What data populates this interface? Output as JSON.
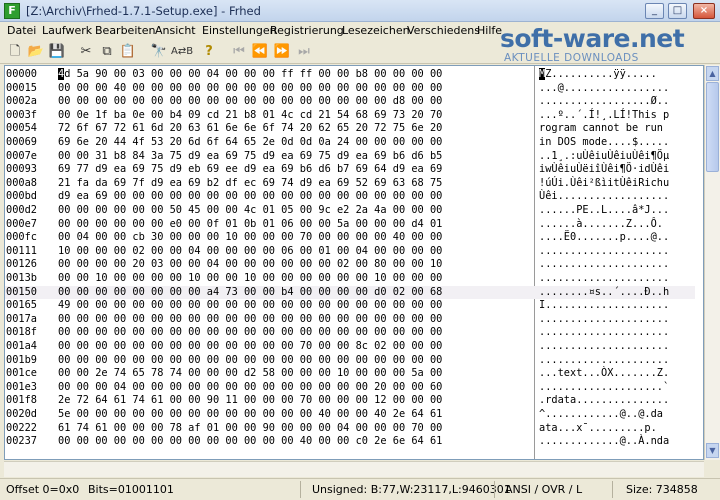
{
  "window": {
    "title": "[Z:\\Archiv\\Frhed-1.7.1-Setup.exe] - Frhed",
    "app_icon_letter": "F",
    "controls": {
      "minimize": "_",
      "maximize": "□",
      "close": "×"
    }
  },
  "menu": [
    "Datei",
    "Laufwerk",
    "Bearbeiten",
    "Ansicht",
    "Einstellungen",
    "Registrierung",
    "Lesezeichen",
    "Verschiedens",
    "Hilfe"
  ],
  "toolbar_icons": [
    "new-file-icon",
    "open-folder-icon",
    "save-icon",
    "cut-icon",
    "copy-icon",
    "paste-icon",
    "find-icon",
    "replace-icon",
    "help-icon",
    "first-icon",
    "prev-icon",
    "next-icon",
    "last-icon"
  ],
  "watermark": {
    "logo": "soft-ware.net",
    "subtitle": "AKTUELLE DOWNLOADS"
  },
  "hex": {
    "rows": [
      {
        "offset": "00000",
        "bytes": "4d 5a 90 00 03 00 00 00 04 00 00 00 ff ff 00 00 b8 00 00 00 00",
        "ascii": "MZ..........ÿÿ....."
      },
      {
        "offset": "00015",
        "bytes": "00 00 00 40 00 00 00 00 00 00 00 00 00 00 00 00 00 00 00 00 00",
        "ascii": "...@................."
      },
      {
        "offset": "0002a",
        "bytes": "00 00 00 00 00 00 00 00 00 00 00 00 00 00 00 00 00 00 d8 00 00",
        "ascii": "..................Ø.."
      },
      {
        "offset": "0003f",
        "bytes": "00 0e 1f ba 0e 00 b4 09 cd 21 b8 01 4c cd 21 54 68 69 73 20 70",
        "ascii": "...º..´.Í!¸.LÍ!This p"
      },
      {
        "offset": "00054",
        "bytes": "72 6f 67 72 61 6d 20 63 61 6e 6e 6f 74 20 62 65 20 72 75 6e 20",
        "ascii": "rogram cannot be run"
      },
      {
        "offset": "00069",
        "bytes": "69 6e 20 44 4f 53 20 6d 6f 64 65 2e 0d 0d 0a 24 00 00 00 00 00",
        "ascii": "in DOS mode....$....."
      },
      {
        "offset": "0007e",
        "bytes": "00 00 31 b8 84 3a 75 d9 ea 69 75 d9 ea 69 75 d9 ea 69 b6 d6 b5",
        "ascii": "..1¸.:uÙêiuÙêiuÙêi¶Öµ"
      },
      {
        "offset": "00093",
        "bytes": "69 77 d9 ea 69 75 d9 eb 69 ee d9 ea 69 b6 d6 b7 69 64 d9 ea 69",
        "ascii": "iwÙêiuÙëiîÙêi¶Ö·idÙêi"
      },
      {
        "offset": "000a8",
        "bytes": "21 fa da 69 7f d9 ea 69 b2 df ec 69 74 d9 ea 69 52 69 63 68 75",
        "ascii": "!úÚi.Ùêi²ßìitÙêiRichu"
      },
      {
        "offset": "000bd",
        "bytes": "d9 ea 69 00 00 00 00 00 00 00 00 00 00 00 00 00 00 00 00 00 00",
        "ascii": "Ùêi.................."
      },
      {
        "offset": "000d2",
        "bytes": "00 00 00 00 00 00 50 45 00 00 4c 01 05 00 9c e2 2a 4a 00 00 00",
        "ascii": "......PE..L....â*J..."
      },
      {
        "offset": "000e7",
        "bytes": "00 00 00 00 00 00 e0 00 0f 01 0b 01 06 00 00 5a 00 00 00 d4 01",
        "ascii": "......à.......Z...Ô."
      },
      {
        "offset": "000fc",
        "bytes": "00 04 00 00 cb 30 00 00 00 10 00 00 00 70 00 00 00 00 40 00 00",
        "ascii": "....Ë0.......p....@.."
      },
      {
        "offset": "00111",
        "bytes": "10 00 00 00 02 00 00 04 00 00 00 00 06 00 01 00 04 00 00 00 00",
        "ascii": "....................."
      },
      {
        "offset": "00126",
        "bytes": "00 00 00 00 20 03 00 00 04 00 00 00 00 00 00 02 00 80 00 00 10",
        "ascii": "....................."
      },
      {
        "offset": "0013b",
        "bytes": "00 00 10 00 00 00 00 10 00 00 10 00 00 00 00 00 00 10 00 00 00",
        "ascii": "....................."
      },
      {
        "offset": "00150",
        "bookmark": true,
        "bytes": "00 00 00 00 00 00 00 00 a4 73 00 00 b4 00 00 00 00 d0 02 00 68",
        "ascii": "........¤s..´....Ð..h"
      },
      {
        "offset": "00165",
        "bytes": "49 00 00 00 00 00 00 00 00 00 00 00 00 00 00 00 00 00 00 00 00",
        "ascii": "I...................."
      },
      {
        "offset": "0017a",
        "bytes": "00 00 00 00 00 00 00 00 00 00 00 00 00 00 00 00 00 00 00 00 00",
        "ascii": "....................."
      },
      {
        "offset": "0018f",
        "bytes": "00 00 00 00 00 00 00 00 00 00 00 00 00 00 00 00 00 00 00 00 00",
        "ascii": "....................."
      },
      {
        "offset": "001a4",
        "bytes": "00 00 00 00 00 00 00 00 00 00 00 00 00 70 00 00 8c 02 00 00 00",
        "ascii": "....................."
      },
      {
        "offset": "001b9",
        "bytes": "00 00 00 00 00 00 00 00 00 00 00 00 00 00 00 00 00 00 00 00 00",
        "ascii": "....................."
      },
      {
        "offset": "001ce",
        "bytes": "00 00 2e 74 65 78 74 00 00 00 d2 58 00 00 00 10 00 00 00 5a 00",
        "ascii": "...text...ÒX.......Z."
      },
      {
        "offset": "001e3",
        "bytes": "00 00 00 04 00 00 00 00 00 00 00 00 00 00 00 00 00 20 00 00 60",
        "ascii": "....................`"
      },
      {
        "offset": "001f8",
        "bytes": "2e 72 64 61 74 61 00 00 90 11 00 00 00 70 00 00 00 12 00 00 00",
        "ascii": ".rdata..............."
      },
      {
        "offset": "0020d",
        "bytes": "5e 00 00 00 00 00 00 00 00 00 00 00 00 00 40 00 00 40 2e 64 61",
        "ascii": "^............@..@.da"
      },
      {
        "offset": "00222",
        "bytes": "61 74 61 00 00 00 78 af 01 00 00 90 00 00 00 04 00 00 00 70 00",
        "ascii": "ata...x¯.........p."
      },
      {
        "offset": "00237",
        "bytes": "00 00 00 00 00 00 00 00 00 00 00 00 00 40 00 00 c0 2e 6e 64 61",
        "ascii": ".............@..À.nda"
      }
    ]
  },
  "status": {
    "offset": "Offset 0=0x0",
    "bits": "Bits=01001101",
    "unsigned": "Unsigned: B:77,W:23117,L:9460301",
    "mode": "ANSI / OVR / L",
    "size": "Size: 734858"
  }
}
